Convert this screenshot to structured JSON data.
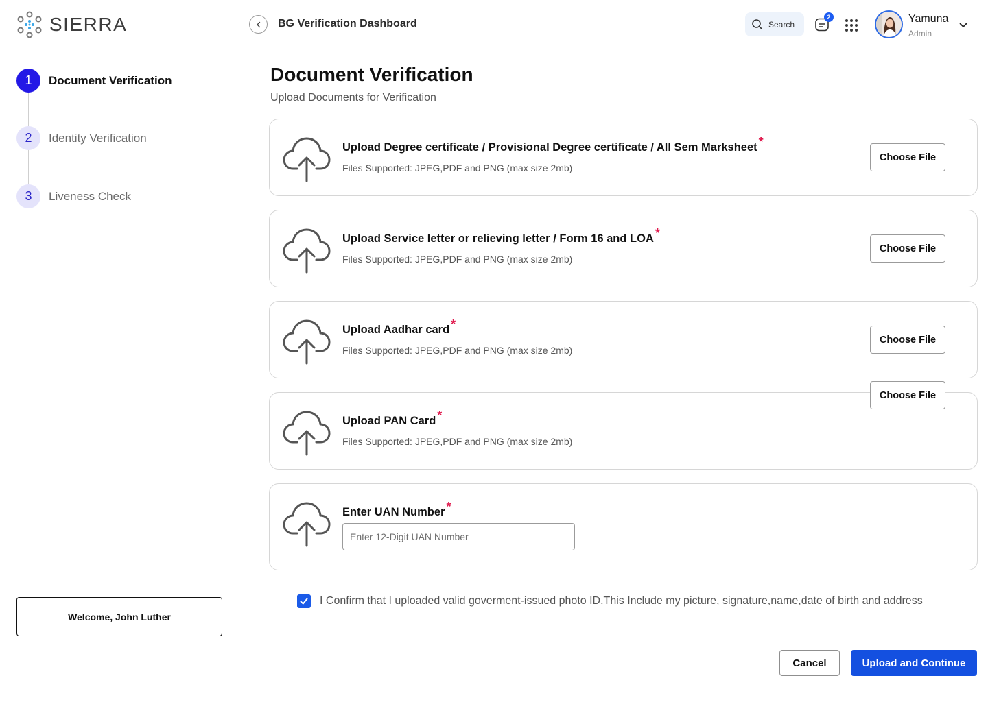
{
  "brand": {
    "name": "SIERRA",
    "accent": "#2318e6"
  },
  "header": {
    "title": "BG Verification Dashboard",
    "search_label": "Search",
    "notification_count": "2",
    "user": {
      "name": "Yamuna",
      "role": "Admin"
    }
  },
  "steps": [
    {
      "number": "1",
      "label": "Document Verification",
      "state": "active"
    },
    {
      "number": "2",
      "label": "Identity Verification",
      "state": "inactive"
    },
    {
      "number": "3",
      "label": "Liveness Check",
      "state": "inactive"
    }
  ],
  "welcome": "Welcome, John Luther",
  "main": {
    "title": "Document Verification",
    "subtitle": "Upload Documents for Verification"
  },
  "uploads": [
    {
      "title": "Upload  Degree certificate / Provisional Degree certificate / All Sem Marksheet",
      "required": "*",
      "hint": "Files Supported: JPEG,PDF and PNG (max size 2mb)",
      "button": "Choose File"
    },
    {
      "title": "Upload  Service letter or relieving letter / Form 16 and LOA",
      "required": "*",
      "hint": "Files Supported: JPEG,PDF and PNG (max size 2mb)",
      "button": "Choose File"
    },
    {
      "title": "Upload Aadhar card",
      "required": "*",
      "hint": "Files Supported: JPEG,PDF and PNG (max size 2mb)",
      "button": "Choose File"
    },
    {
      "title": "Upload PAN Card",
      "required": "*",
      "hint": "Files Supported: JPEG,PDF and PNG (max size 2mb)",
      "button": "Choose File"
    }
  ],
  "uan": {
    "title": "Enter UAN Number",
    "required": "*",
    "placeholder": "Enter 12-Digit UAN Number",
    "value": ""
  },
  "confirm": {
    "checked": true,
    "text": "I Confirm that I uploaded valid goverment-issued photo ID.This Include my picture, signature,name,date of birth and address"
  },
  "actions": {
    "cancel": "Cancel",
    "submit": "Upload and Continue"
  }
}
